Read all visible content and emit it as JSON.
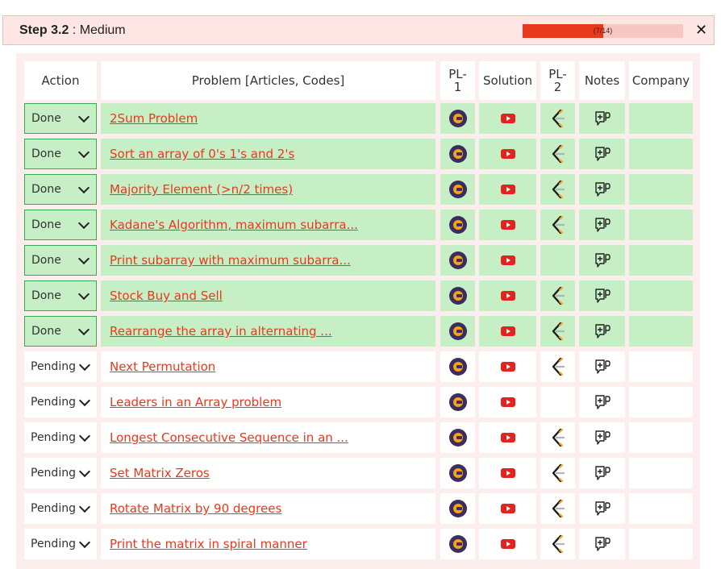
{
  "header": {
    "step_label": "Step 3.2",
    "step_sep": " : ",
    "difficulty": "Medium",
    "progress_text": "(7/14)",
    "progress_fraction": 0.5,
    "close_symbol": "✕"
  },
  "columns": [
    "Action",
    "Problem [Articles, Codes]",
    "PL-\n1",
    "Solution",
    "PL-\n2",
    "Notes",
    "Company"
  ],
  "colors": {
    "accent": "#e8391c",
    "done_bg": "#c6efc6",
    "done_border": "#34a853",
    "header_bg": "#fde6e4"
  },
  "rows": [
    {
      "status": "Done",
      "title": "2Sum Problem",
      "pl2": true
    },
    {
      "status": "Done",
      "title": "Sort an array of 0's 1's and 2's",
      "pl2": true
    },
    {
      "status": "Done",
      "title": "Majority Element (>n/2 times)",
      "pl2": true
    },
    {
      "status": "Done",
      "title": "Kadane's Algorithm, maximum subarra...",
      "pl2": true
    },
    {
      "status": "Done",
      "title": "Print subarray with maximum subarra...",
      "pl2": false
    },
    {
      "status": "Done",
      "title": "Stock Buy and Sell",
      "pl2": true
    },
    {
      "status": "Done",
      "title": "Rearrange the array in alternating ...",
      "pl2": true
    },
    {
      "status": "Pending",
      "title": "Next Permutation",
      "pl2": true
    },
    {
      "status": "Pending",
      "title": "Leaders in an Array problem",
      "pl2": false
    },
    {
      "status": "Pending",
      "title": "Longest Consecutive Sequence in an ...",
      "pl2": true
    },
    {
      "status": "Pending",
      "title": "Set Matrix Zeros",
      "pl2": true
    },
    {
      "status": "Pending",
      "title": "Rotate Matrix by 90 degrees",
      "pl2": true
    },
    {
      "status": "Pending",
      "title": "Print the matrix in spiral manner",
      "pl2": true
    }
  ]
}
